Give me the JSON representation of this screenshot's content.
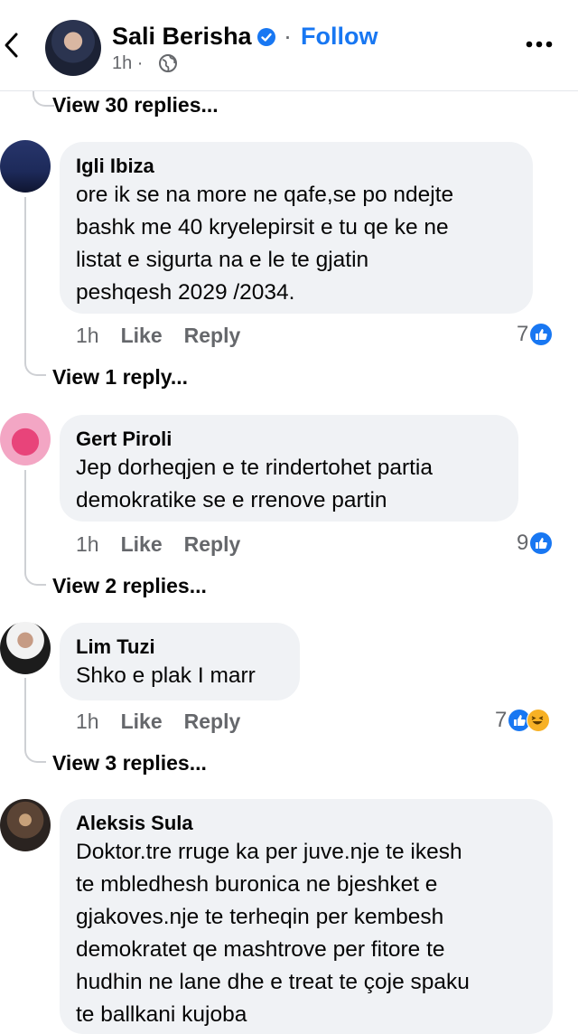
{
  "header": {
    "page_name": "Sali Berisha",
    "follow_label": "Follow",
    "separator": "·",
    "time": "1h ·"
  },
  "comments": [
    {
      "view_replies_above": "View 30 replies...",
      "author": "Igli Ibiza",
      "text": "ore ik se na more ne qafe,se po ndejte\nbashk me 40 kryelepirsit e tu qe ke ne\nlistat e sigurta na e le te gjatin\npeshqesh 2029 /2034.",
      "time": "1h",
      "like": "Like",
      "reply": "Reply",
      "reaction_count": "7",
      "view_replies": "View 1 reply..."
    },
    {
      "author": "Gert Piroli",
      "text": "Jep dorheqjen e te rindertohet partia\ndemokratike se e rrenove partin",
      "time": "1h",
      "like": "Like",
      "reply": "Reply",
      "reaction_count": "9",
      "view_replies": "View 2 replies..."
    },
    {
      "author": "Lim Tuzi",
      "text": "Shko e plak I marr",
      "time": "1h",
      "like": "Like",
      "reply": "Reply",
      "reaction_count": "7",
      "view_replies": "View 3 replies..."
    },
    {
      "author": "Aleksis Sula",
      "text": "Doktor.tre rruge ka per juve.nje te ikesh\nte mbledhesh buronica ne bjeshket e\ngjakoves.nje te terheqin per kembesh\ndemokratet qe mashtrove per fitore te\nhudhin ne lane dhe e treat te çoje spaku\nte ballkani kujoba"
    }
  ],
  "colors": {
    "accent": "#1877f2",
    "bubble": "#f0f2f5",
    "muted": "#65676b",
    "haha": "#f7b125"
  },
  "icons": [
    "back-arrow-icon",
    "verified-badge-icon",
    "globe-icon",
    "more-options-icon",
    "like-reaction-icon",
    "haha-reaction-icon"
  ]
}
